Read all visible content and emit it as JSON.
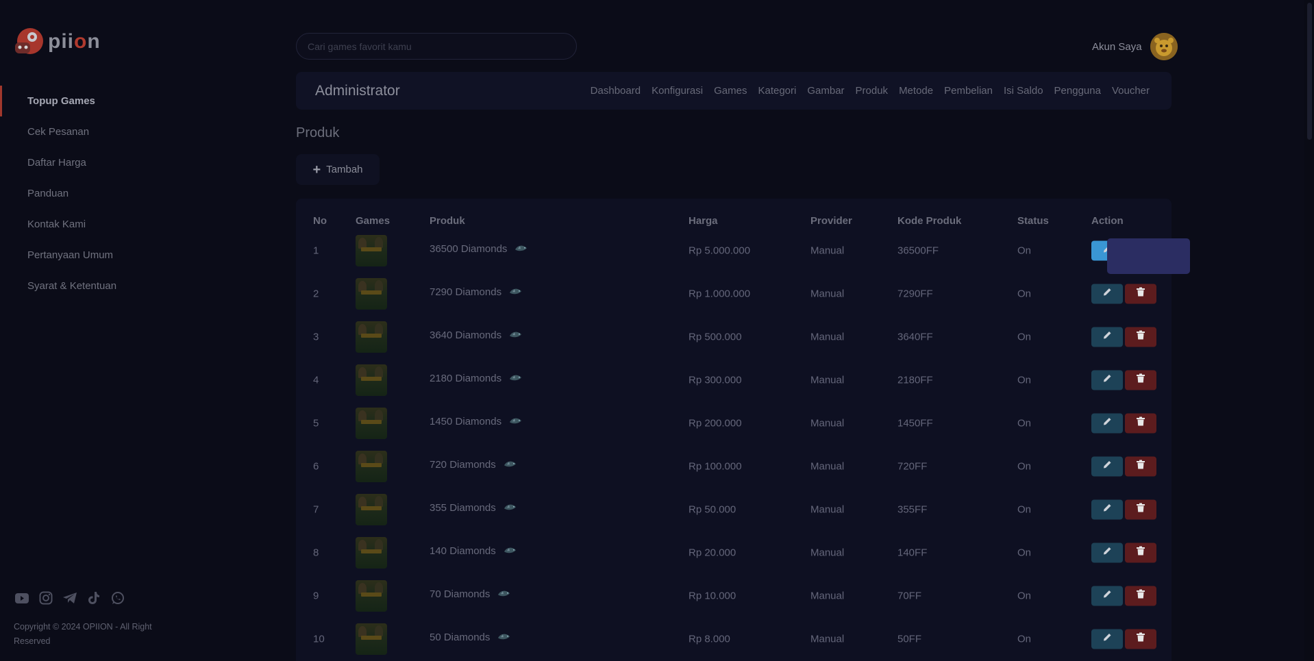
{
  "brand": {
    "name_prefix": "pii",
    "name_o": "o",
    "name_suffix": "n"
  },
  "sidebar": {
    "items": [
      {
        "label": "Topup Games",
        "active": true
      },
      {
        "label": "Cek Pesanan",
        "active": false
      },
      {
        "label": "Daftar Harga",
        "active": false
      },
      {
        "label": "Panduan",
        "active": false
      },
      {
        "label": "Kontak Kami",
        "active": false
      },
      {
        "label": "Pertanyaan Umum",
        "active": false
      },
      {
        "label": "Syarat & Ketentuan",
        "active": false
      }
    ],
    "socials": [
      "youtube-icon",
      "instagram-icon",
      "telegram-icon",
      "tiktok-icon",
      "whatsapp-icon"
    ],
    "copyright": "Copyright © 2024 OPIION - All Right Reserved"
  },
  "header": {
    "search_placeholder": "Cari games favorit kamu",
    "account_label": "Akun Saya"
  },
  "admin": {
    "title": "Administrator",
    "menu": [
      "Dashboard",
      "Konfigurasi",
      "Games",
      "Kategori",
      "Gambar",
      "Produk",
      "Metode",
      "Pembelian",
      "Isi Saldo",
      "Pengguna",
      "Voucher"
    ]
  },
  "page": {
    "title": "Produk",
    "add_label": "Tambah"
  },
  "table": {
    "headers": {
      "no": "No",
      "games": "Games",
      "produk": "Produk",
      "harga": "Harga",
      "provider": "Provider",
      "kode": "Kode Produk",
      "status": "Status",
      "action": "Action"
    },
    "rows": [
      {
        "no": "1",
        "produk": "36500 Diamonds",
        "harga": "Rp 5.000.000",
        "provider": "Manual",
        "kode": "36500FF",
        "status": "On"
      },
      {
        "no": "2",
        "produk": "7290 Diamonds",
        "harga": "Rp 1.000.000",
        "provider": "Manual",
        "kode": "7290FF",
        "status": "On"
      },
      {
        "no": "3",
        "produk": "3640 Diamonds",
        "harga": "Rp 500.000",
        "provider": "Manual",
        "kode": "3640FF",
        "status": "On"
      },
      {
        "no": "4",
        "produk": "2180 Diamonds",
        "harga": "Rp 300.000",
        "provider": "Manual",
        "kode": "2180FF",
        "status": "On"
      },
      {
        "no": "5",
        "produk": "1450 Diamonds",
        "harga": "Rp 200.000",
        "provider": "Manual",
        "kode": "1450FF",
        "status": "On"
      },
      {
        "no": "6",
        "produk": "720 Diamonds",
        "harga": "Rp 100.000",
        "provider": "Manual",
        "kode": "720FF",
        "status": "On"
      },
      {
        "no": "7",
        "produk": "355 Diamonds",
        "harga": "Rp 50.000",
        "provider": "Manual",
        "kode": "355FF",
        "status": "On"
      },
      {
        "no": "8",
        "produk": "140 Diamonds",
        "harga": "Rp 20.000",
        "provider": "Manual",
        "kode": "140FF",
        "status": "On"
      },
      {
        "no": "9",
        "produk": "70 Diamonds",
        "harga": "Rp 10.000",
        "provider": "Manual",
        "kode": "70FF",
        "status": "On"
      },
      {
        "no": "10",
        "produk": "50 Diamonds",
        "harga": "Rp 8.000",
        "provider": "Manual",
        "kode": "50FF",
        "status": "On"
      }
    ]
  },
  "colors": {
    "background": "#0b0c18",
    "accent": "#a0382c",
    "edit": "#3a96d4",
    "delete": "#e14a48"
  }
}
